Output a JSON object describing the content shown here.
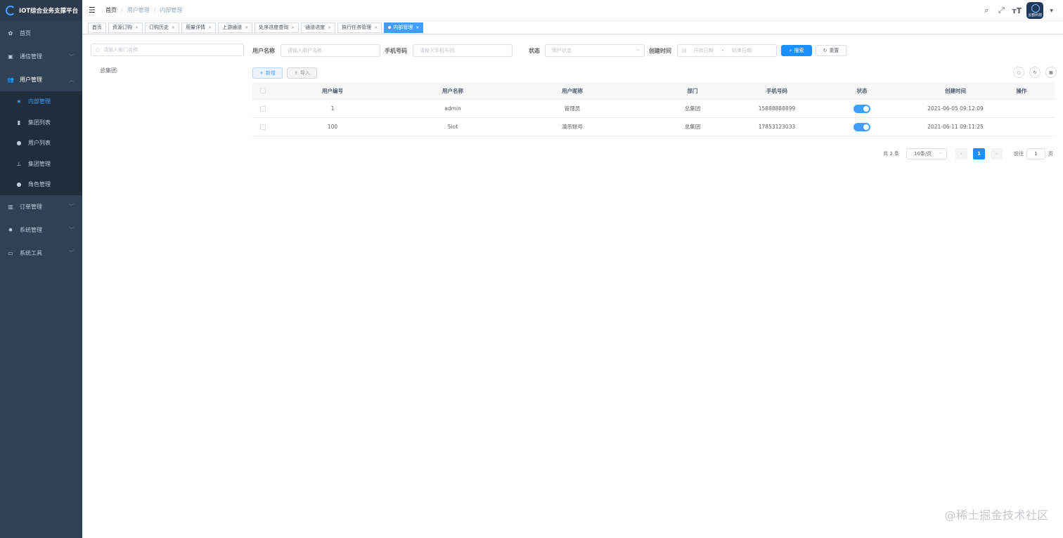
{
  "app": {
    "title": "IOT综合业务支撑平台"
  },
  "sidebar": {
    "items": [
      {
        "label": "首页",
        "icon": "dashboard-icon"
      },
      {
        "label": "通信管理",
        "icon": "card-icon"
      },
      {
        "label": "用户管理",
        "icon": "users-icon"
      },
      {
        "label": "订单管理",
        "icon": "bar-chart-icon"
      },
      {
        "label": "系统管理",
        "icon": "gear-icon"
      },
      {
        "label": "系统工具",
        "icon": "toolbox-icon"
      }
    ],
    "submenu": [
      {
        "label": "内部管理",
        "icon": "star-icon",
        "active": true
      },
      {
        "label": "集团列表",
        "icon": "book-icon"
      },
      {
        "label": "用户列表",
        "icon": "user-icon"
      },
      {
        "label": "集团管理",
        "icon": "tree-icon"
      },
      {
        "label": "角色管理",
        "icon": "peoples-icon"
      }
    ]
  },
  "breadcrumb": [
    "首页",
    "用户管理",
    "内部管理"
  ],
  "avatar_text": "云鹤科技",
  "tags": [
    {
      "label": "首页",
      "closable": false
    },
    {
      "label": "资源订购",
      "closable": true
    },
    {
      "label": "订购历史",
      "closable": true
    },
    {
      "label": "用量详情",
      "closable": true
    },
    {
      "label": "上游通道",
      "closable": true
    },
    {
      "label": "处序进度查询",
      "closable": true
    },
    {
      "label": "通道进度",
      "closable": true
    },
    {
      "label": "执行任务管理",
      "closable": true
    },
    {
      "label": "内部管理",
      "closable": true,
      "active": true
    }
  ],
  "tree": {
    "search_placeholder": "请输入部门名称",
    "nodes": [
      "总集团"
    ]
  },
  "filters": {
    "username_label": "用户名称",
    "username_placeholder": "请输入用户名称",
    "phone_label": "手机号码",
    "phone_placeholder": "请输入手机号码",
    "status_label": "状态",
    "status_placeholder": "用户状态",
    "created_label": "创建时间",
    "start_placeholder": "开始日期",
    "range_sep": "-",
    "end_placeholder": "结束日期",
    "search_btn": "搜索",
    "reset_btn": "重置"
  },
  "toolbar": {
    "add_btn": "新增",
    "import_btn": "导入"
  },
  "table": {
    "columns": [
      "用户编号",
      "用户名称",
      "用户昵称",
      "部门",
      "手机号码",
      "状态",
      "创建时间",
      "操作"
    ],
    "rows": [
      {
        "id": "1",
        "username": "admin",
        "nickname": "管理员",
        "dept": "总集团",
        "phone": "15888888899",
        "status_on": true,
        "created": "2021-06-05 09:12:09"
      },
      {
        "id": "100",
        "username": "5iot",
        "nickname": "演示账号",
        "dept": "总集团",
        "phone": "17853123033",
        "status_on": true,
        "created": "2021-06-11 09:11:25"
      }
    ]
  },
  "pagination": {
    "total_text": "共 2 条",
    "page_size": "10条/页",
    "current_page": "1",
    "goto_label": "前往",
    "goto_value": "1",
    "page_unit": "页"
  },
  "watermark": "@稀土掘金技术社区",
  "colors": {
    "sidebar_bg": "#304156",
    "primary": "#1890ff",
    "active_menu": "#409eff"
  }
}
